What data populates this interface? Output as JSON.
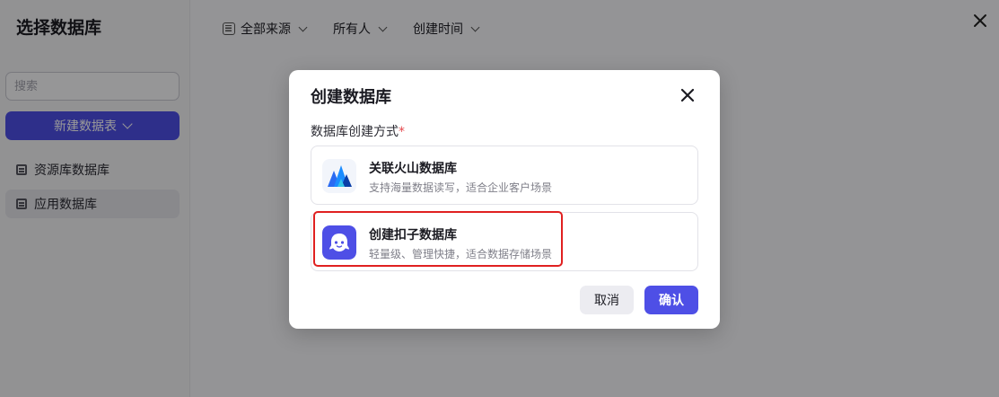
{
  "sidebar": {
    "title": "选择数据库",
    "search_placeholder": "搜索",
    "new_button_label": "新建数据表",
    "items": [
      {
        "label": "资源库数据库",
        "icon": "database-icon"
      },
      {
        "label": "应用数据库",
        "icon": "database-icon",
        "active": true
      }
    ]
  },
  "filters": [
    {
      "label": "全部来源",
      "icon": "source-icon"
    },
    {
      "label": "所有人"
    },
    {
      "label": "创建时间"
    }
  ],
  "modal": {
    "title": "创建数据库",
    "field_label": "数据库创建方式",
    "required_mark": "*",
    "options": [
      {
        "title": "关联火山数据库",
        "desc": "支持海量数据读写，适合企业客户场景",
        "icon": "volcano-logo-icon"
      },
      {
        "title": "创建扣子数据库",
        "desc": "轻量级、管理快捷，适合数据存储场景",
        "icon": "coze-logo-icon"
      }
    ],
    "cancel_label": "取消",
    "confirm_label": "确认"
  },
  "colors": {
    "accent": "#4e4fe6",
    "highlight": "#e02020",
    "required": "#e5484d"
  }
}
